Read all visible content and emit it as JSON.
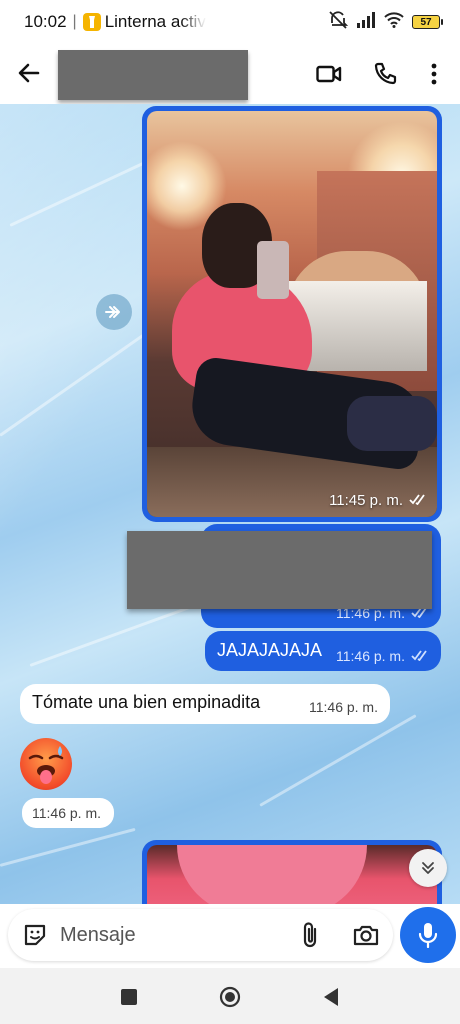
{
  "status_bar": {
    "time": "10:02",
    "notification": "Linterna activ",
    "battery": "57"
  },
  "header": {
    "contact_name": "",
    "actions": [
      "video-call-icon",
      "phone-call-icon",
      "more-vert-icon"
    ]
  },
  "messages": [
    {
      "type": "image",
      "direction": "outgoing",
      "time": "11:45 p. m.",
      "read": true
    },
    {
      "type": "text",
      "direction": "outgoing",
      "text": "",
      "time": "11:46 p. m.",
      "read": true,
      "redacted": true
    },
    {
      "type": "text",
      "direction": "outgoing",
      "text": "JAJAJAJAJA",
      "time": "11:46 p. m.",
      "read": true
    },
    {
      "type": "text",
      "direction": "incoming",
      "text": "Tómate una bien empinadita",
      "time": "11:46 p. m."
    },
    {
      "type": "sticker",
      "direction": "incoming",
      "time": "11:46 p. m."
    },
    {
      "type": "image",
      "direction": "outgoing"
    }
  ],
  "composer": {
    "placeholder": "Mensaje"
  },
  "colors": {
    "outgoing_bubble": "#1f5fe0",
    "incoming_bubble": "#ffffff",
    "mic_button": "#1f6feb"
  }
}
